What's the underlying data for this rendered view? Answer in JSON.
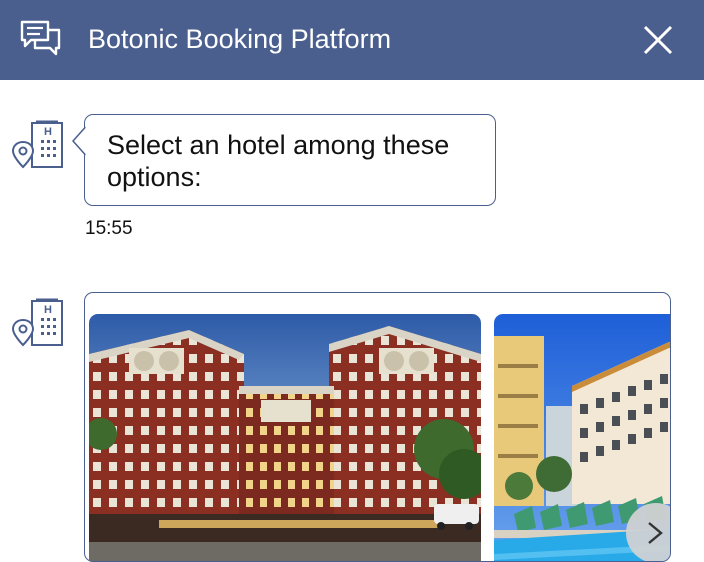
{
  "header": {
    "title": "Botonic Booking Platform",
    "chat_icon": "chat-bubbles-icon",
    "close_icon": "close-icon",
    "background": "#4a5f8e"
  },
  "messages": [
    {
      "avatar_icon": "hotel-location-icon",
      "text": "Select an hotel among these options:",
      "time": "15:55"
    },
    {
      "avatar_icon": "hotel-location-icon",
      "type": "carousel",
      "cards": [
        {
          "image": "hotel-brick-building-photo"
        },
        {
          "image": "hotel-pool-building-photo"
        }
      ],
      "next_icon": "chevron-right-icon"
    }
  ]
}
